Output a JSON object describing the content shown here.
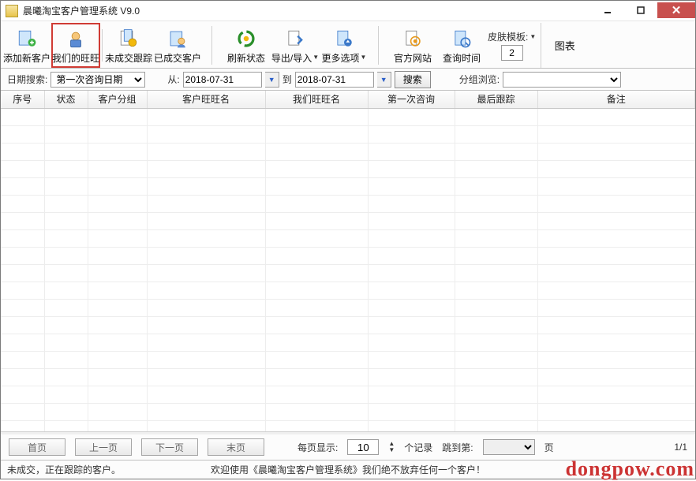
{
  "app": {
    "title": "晨曦淘宝客户管理系统 V9.0"
  },
  "toolbar": {
    "add_customer": "添加新客户",
    "our_wangwang": "我们的旺旺",
    "untracked": "未成交跟踪",
    "closed_customers": "已成交客户",
    "refresh": "刷新状态",
    "import_export": "导出/导入",
    "more_options": "更多选项",
    "official_site": "官方网站",
    "query_time": "查询时间",
    "skin_label": "皮肤模板:",
    "skin_value": "2",
    "chart": "图表"
  },
  "search": {
    "date_search_label": "日期搜索:",
    "date_field_selected": "第一次咨询日期",
    "from_label": "从:",
    "from_date": "2018-07-31",
    "to_label": "到",
    "to_date": "2018-07-31",
    "search_btn": "搜索",
    "group_view_label": "分组浏览:",
    "group_view_selected": ""
  },
  "columns": [
    "序号",
    "状态",
    "客户分组",
    "客户旺旺名",
    "我们旺旺名",
    "第一次咨询",
    "最后跟踪",
    "备注"
  ],
  "pager": {
    "first": "首页",
    "prev": "上一页",
    "next": "下一页",
    "last": "末页",
    "per_page_label": "每页显示:",
    "per_page_value": "10",
    "records_label": "个记录",
    "jump_label": "跳到第:",
    "page_suffix": "页",
    "page_total": "1/1"
  },
  "status": {
    "left": "未成交，正在跟踪的客户。",
    "center_prefix": "欢迎使用《",
    "center_app": "晨曦淘宝客户管理系统",
    "center_suffix": "》我们绝不放弃任何一个客户！",
    "watermark": "dongpow.com"
  }
}
